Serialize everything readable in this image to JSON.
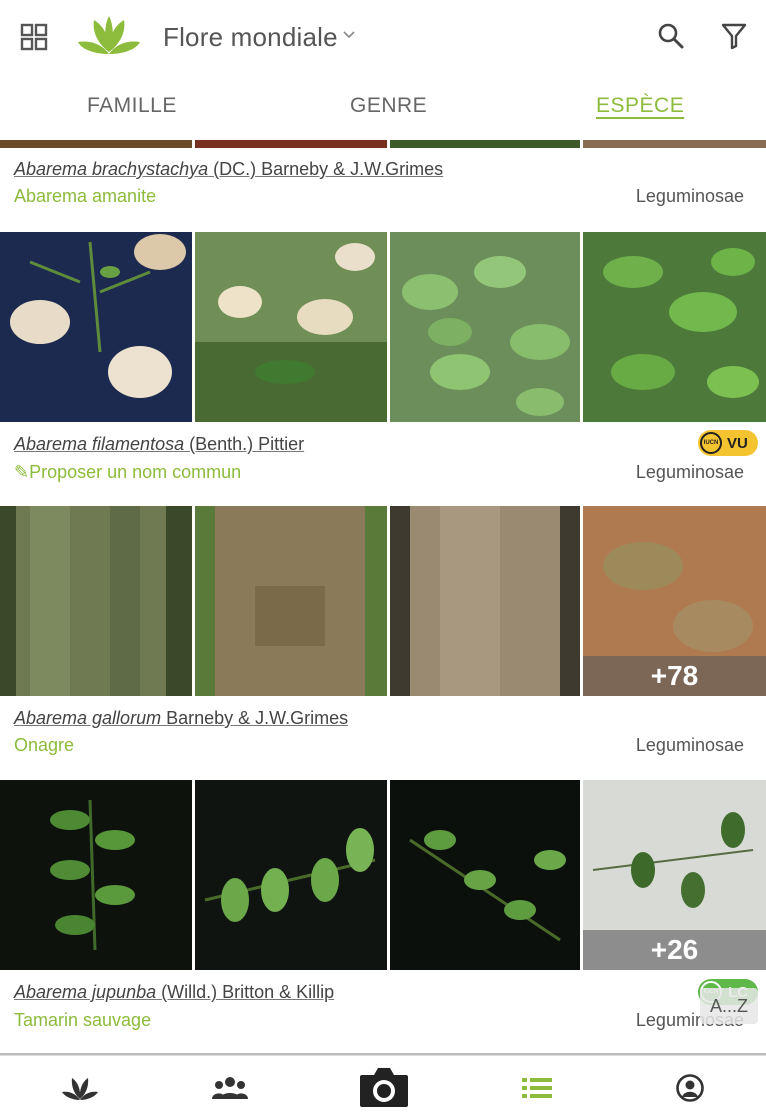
{
  "header": {
    "title": "Flore mondiale",
    "icons": [
      "grid-icon",
      "plantnet-logo",
      "chevron-down-icon",
      "search-icon",
      "filter-icon"
    ]
  },
  "tabs": [
    {
      "label": "FAMILLE",
      "active": false
    },
    {
      "label": "GENRE",
      "active": false
    },
    {
      "label": "ESPÈCE",
      "active": true
    }
  ],
  "species": [
    {
      "genus_species": "Abarema brachystachya",
      "author": "(DC.) Barneby & J.W.Grimes",
      "common_name": "Abarema amanite",
      "family": "Leguminosae"
    },
    {
      "genus_species": "Abarema filamentosa",
      "author": "(Benth.) Pittier",
      "common_name": "Proposer un nom commun",
      "family": "Leguminosae",
      "iucn": "VU",
      "photos": [
        "flowers",
        "flowers",
        "leaves",
        "leaves"
      ]
    },
    {
      "genus_species": "Abarema gallorum",
      "author": "Barneby & J.W.Grimes",
      "common_name": "Onagre",
      "family": "Leguminosae",
      "more_photos": "+78",
      "photos": [
        "bark",
        "bark",
        "bark",
        "bark"
      ]
    },
    {
      "genus_species": "Abarema jupunba",
      "author": "(Willd.) Britton & Killip",
      "common_name": "Tamarin sauvage",
      "family": "Leguminosae",
      "iucn": "LC",
      "more_photos": "+26",
      "photos": [
        "leaves",
        "leaves",
        "leaves",
        "leaves"
      ]
    }
  ],
  "iucn_label": "IUCN",
  "sort_badge": "A...Z",
  "colors": {
    "accent": "#8dbb3b",
    "iucn_vu": "#f4c430",
    "iucn_lc": "#5fb84a"
  },
  "bottom_nav": [
    {
      "icon": "plant-icon",
      "active": false
    },
    {
      "icon": "people-icon",
      "active": false
    },
    {
      "icon": "camera-icon",
      "active": false
    },
    {
      "icon": "list-icon",
      "active": true
    },
    {
      "icon": "profile-icon",
      "active": false
    }
  ]
}
